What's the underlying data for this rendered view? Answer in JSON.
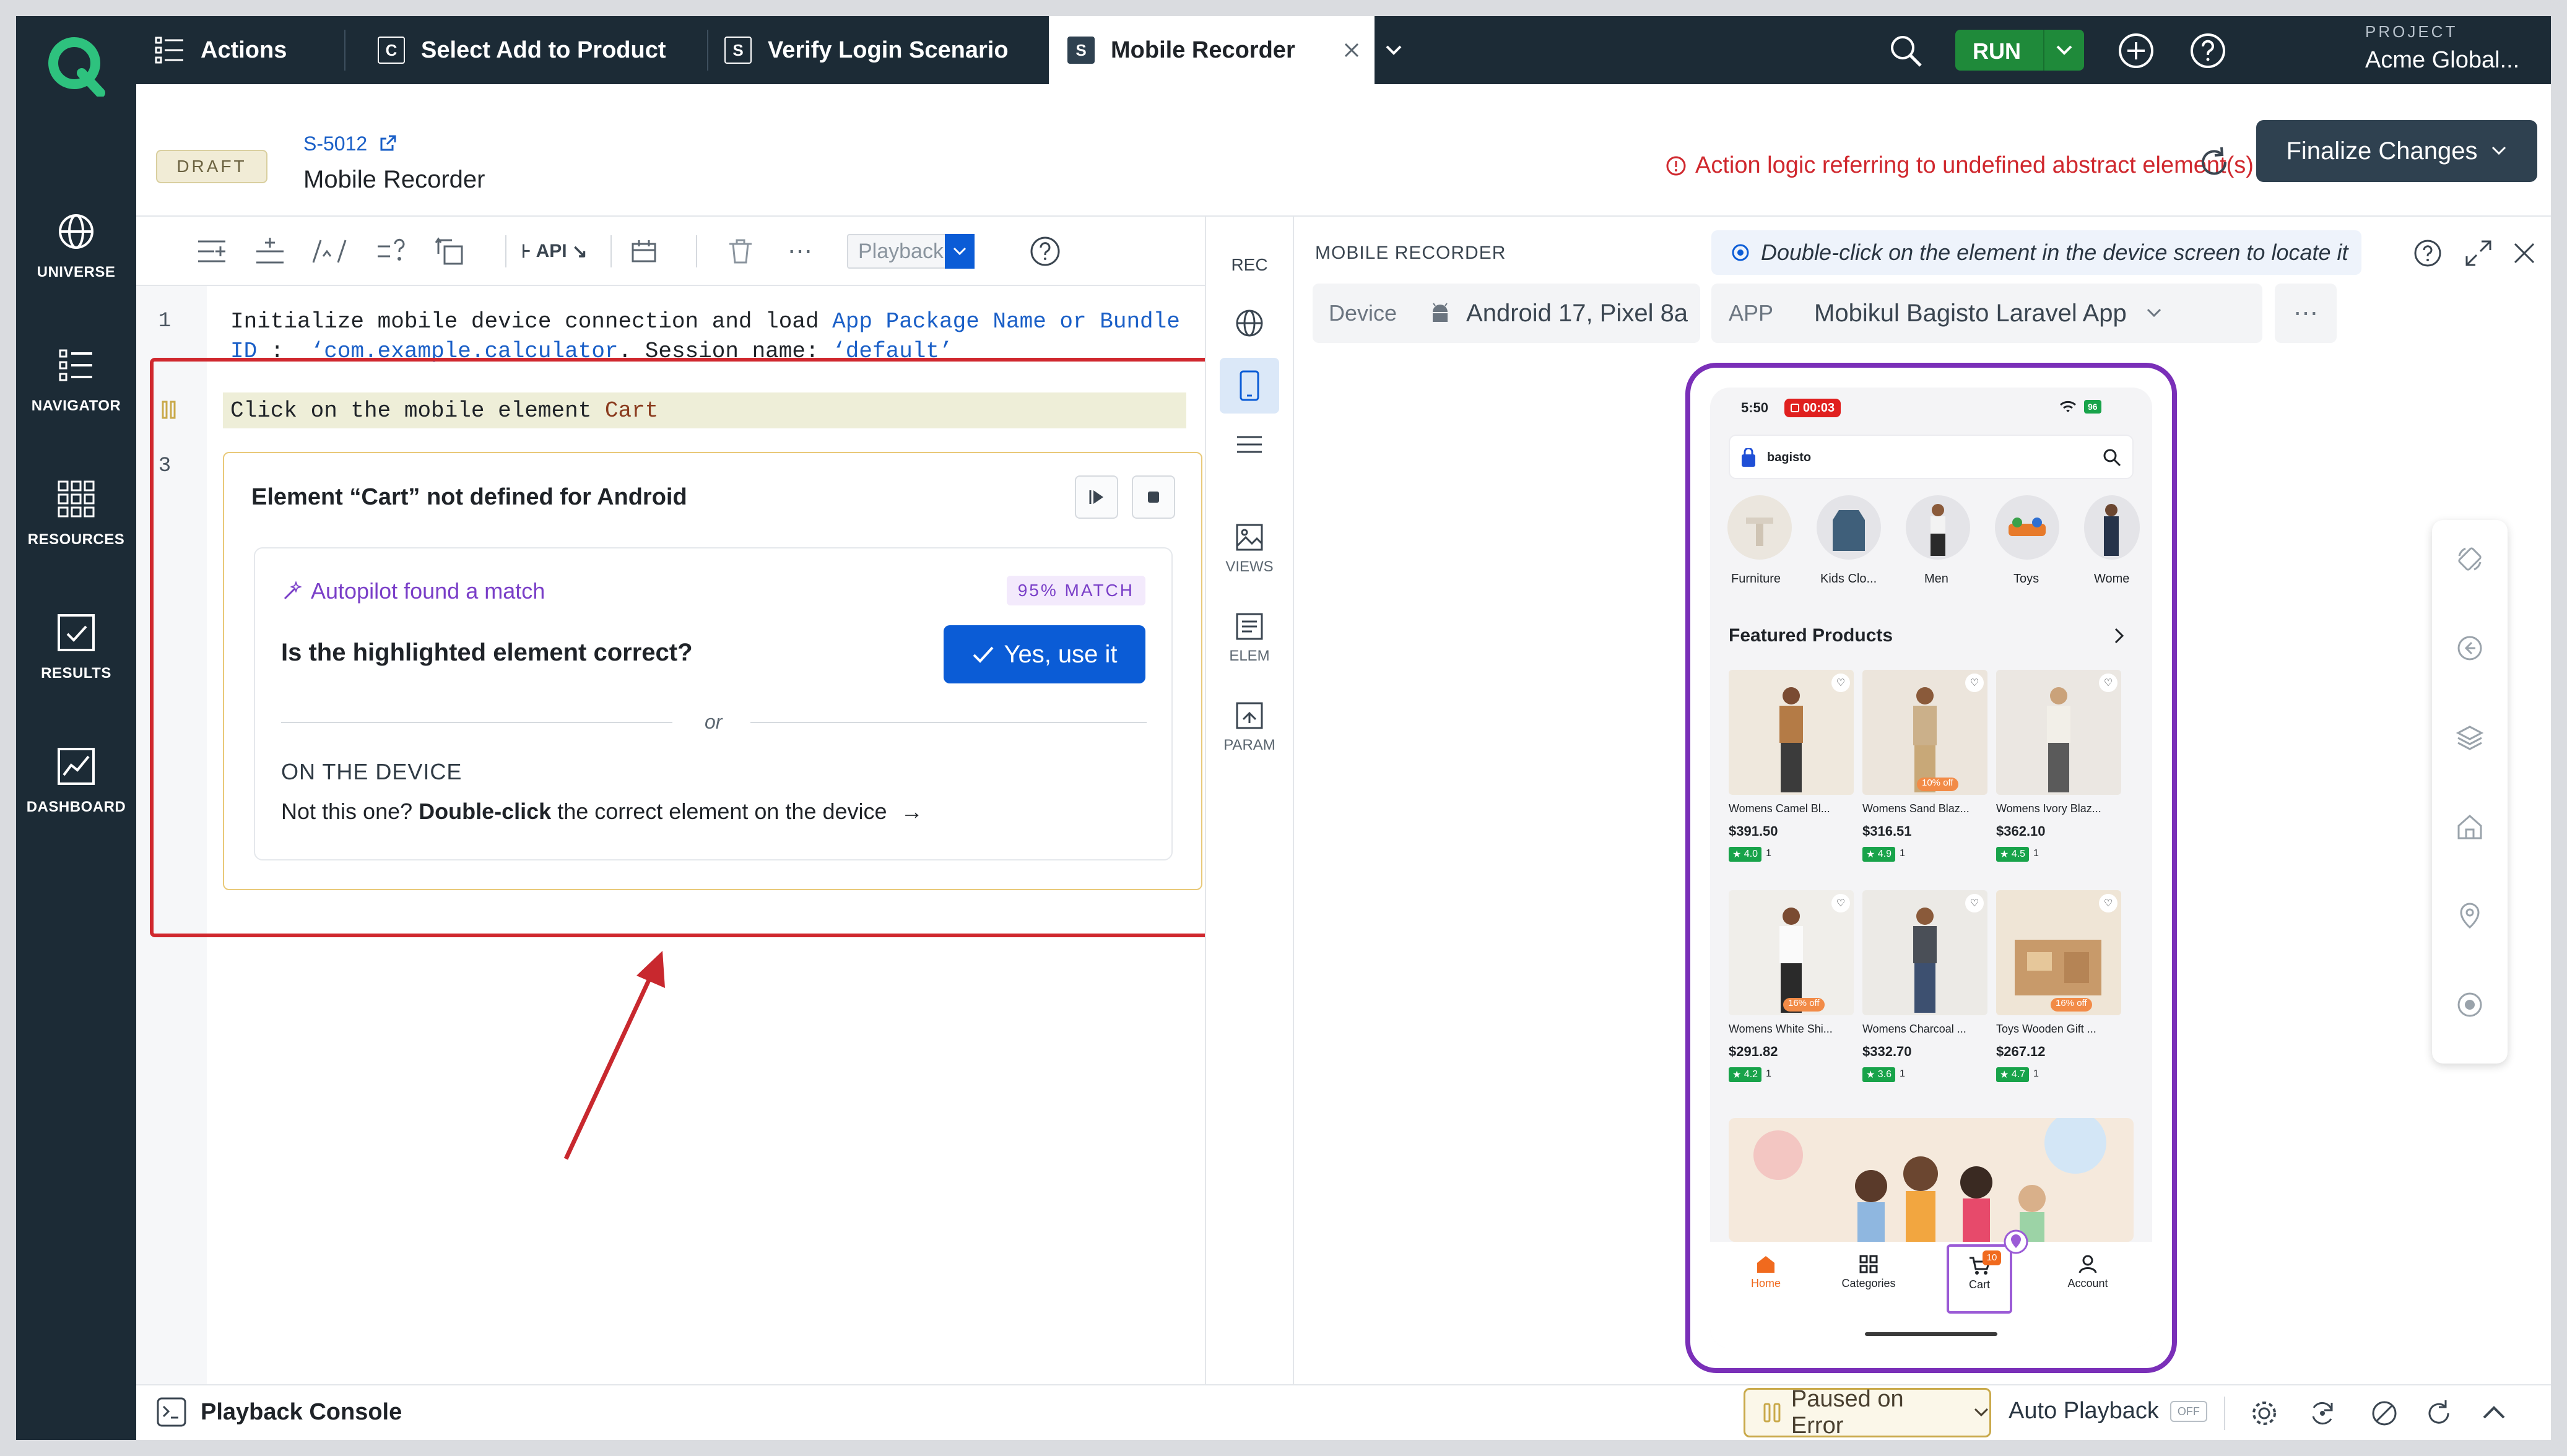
{
  "nav": {
    "items": [
      {
        "label": "UNIVERSE",
        "icon": "globe-icon"
      },
      {
        "label": "NAVIGATOR",
        "icon": "list-icon"
      },
      {
        "label": "RESOURCES",
        "icon": "grid-icon"
      },
      {
        "label": "RESULTS",
        "icon": "checkbox-icon"
      },
      {
        "label": "DASHBOARD",
        "icon": "chart-icon"
      }
    ]
  },
  "tabs": [
    {
      "label": "Actions",
      "badge": ""
    },
    {
      "label": "Select Add to Product",
      "badge": "C"
    },
    {
      "label": "Verify Login Scenario",
      "badge": "S"
    },
    {
      "label": "Mobile Recorder",
      "badge": "S"
    }
  ],
  "topbar": {
    "run_label": "RUN",
    "project_label": "PROJECT",
    "project_name": "Acme Global..."
  },
  "header": {
    "status": "DRAFT",
    "id": "S-5012",
    "title": "Mobile Recorder",
    "error": "Action logic referring to undefined abstract element(s)",
    "finalize_label": "Finalize Changes"
  },
  "toolbar": {
    "api_label": "API",
    "playback_label": "Playback"
  },
  "editor": {
    "lines": [
      {
        "number": "1",
        "part1": "Initialize mobile device connection and load ",
        "kw1": "App Package Name or Bundle",
        "part2": "ID :  ",
        "str1": "‘com.example.calculator",
        "part3": ". Session name: ",
        "str2": "‘default’"
      },
      {
        "number": "",
        "prefix": "Click on the mobile element ",
        "target": "Cart"
      },
      {
        "number": "3"
      }
    ]
  },
  "card": {
    "title": "Element “Cart” not defined for Android",
    "autopilot": "Autopilot found a match",
    "match": "95% MATCH",
    "question": "Is the highlighted element correct?",
    "yes_label": "Yes, use it",
    "or": "or",
    "on_device": "ON THE DEVICE",
    "not_one_prefix": "Not this one?",
    "not_one_bold": "Double-click",
    "not_one_suffix": "the correct element on the device"
  },
  "rail": {
    "rec": "REC",
    "views": "VIEWS",
    "elem": "ELEM",
    "param": "PARAM"
  },
  "recorder": {
    "title": "MOBILE RECORDER",
    "hint": "Double-click on the element in the device screen to locate it",
    "device_label": "Device",
    "device_value": "Android 17, Pixel 8a",
    "app_label": "APP",
    "app_value": "Mobikul Bagisto Laravel App"
  },
  "phone": {
    "time": "5:50",
    "rec_time": "00:03",
    "battery": "96",
    "search_brand": "bagisto",
    "categories": [
      "Furniture",
      "Kids Clo...",
      "Men",
      "Toys",
      "Wome"
    ],
    "featured": "Featured Products",
    "products": [
      {
        "name": "Womens Camel Bl...",
        "price": "$391.50",
        "rating": "4.0",
        "count": "1",
        "off": ""
      },
      {
        "name": "Womens Sand Blaz...",
        "price": "$316.51",
        "rating": "4.9",
        "count": "1",
        "off": "10% off"
      },
      {
        "name": "Womens Ivory Blaz...",
        "price": "$362.10",
        "rating": "4.5",
        "count": "1",
        "off": ""
      },
      {
        "name": "Womens White Shi...",
        "price": "$291.82",
        "rating": "4.2",
        "count": "1",
        "off": "16% off"
      },
      {
        "name": "Womens Charcoal ...",
        "price": "$332.70",
        "rating": "3.6",
        "count": "1",
        "off": ""
      },
      {
        "name": "Toys Wooden Gift ...",
        "price": "$267.12",
        "rating": "4.7",
        "count": "1",
        "off": "16% off"
      }
    ],
    "bottom_nav": [
      "Home",
      "Categories",
      "Cart",
      "Account"
    ],
    "cart_badge": "10"
  },
  "bottombar": {
    "console": "Playback Console",
    "paused": "Paused on Error",
    "auto": "Auto Playback",
    "off": "OFF"
  },
  "colors": {
    "nav_bg": "#1c2b36",
    "run_green": "#1f8a3a",
    "error_red": "#d0282e",
    "primary_blue": "#0b5cd6",
    "autopilot_purple": "#7a3fc8",
    "phone_frame": "#7a2fb8"
  }
}
